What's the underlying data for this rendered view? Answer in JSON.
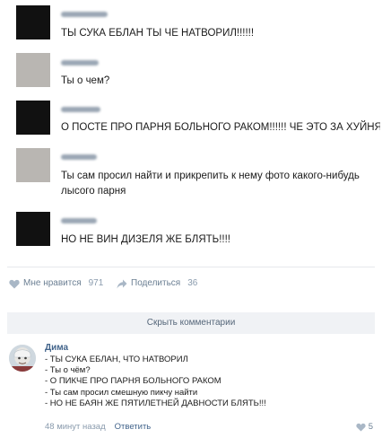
{
  "post_image": {
    "messages": [
      {
        "avatar": "dark",
        "text": "ТЫ СУКА ЕБЛАН ТЫ ЧЕ НАТВОРИЛ!!!!!!"
      },
      {
        "avatar": "light",
        "text": "Ты о чем?"
      },
      {
        "avatar": "dark",
        "text": "О ПОСТЕ ПРО ПАРНЯ БОЛЬНОГО РАКОМ!!!!!! ЧЕ ЭТО ЗА ХУЙНЯ??"
      },
      {
        "avatar": "light",
        "text": "Ты сам просил найти и прикрепить к нему фото какого-нибудь лысого парня"
      },
      {
        "avatar": "dark",
        "text": "НО НЕ ВИН ДИЗЕЛЯ ЖЕ БЛЯТЬ!!!!"
      }
    ]
  },
  "actions": {
    "like_label": "Мне нравится",
    "like_count": "971",
    "share_label": "Поделиться",
    "share_count": "36"
  },
  "hide_comments_label": "Скрыть комментарии",
  "comment": {
    "author": "Дима",
    "lines": [
      "- ТЫ СУКА ЕБЛАН, ЧТО НАТВОРИЛ",
      "- Ты о чём?",
      "- О ПИКЧЕ ПРО ПАРНЯ БОЛЬНОГО РАКОМ",
      "- Ты сам просил смешную пикчу найти",
      "- НО НЕ БАЯН ЖЕ ПЯТИЛЕТНЕЙ ДАВНОСТИ БЛЯТЬ!!!"
    ],
    "time": "48 минут назад",
    "reply_label": "Ответить",
    "likes": "5"
  },
  "colors": {
    "link": "#42648b",
    "muted": "#8a9bad",
    "button_bg": "#f0f2f5"
  }
}
